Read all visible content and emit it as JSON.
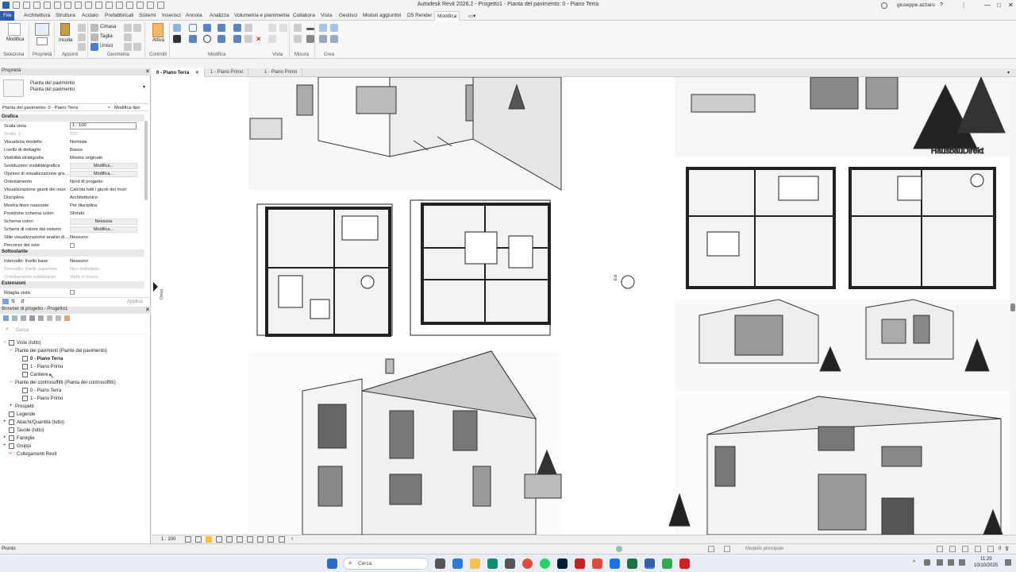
{
  "window": {
    "title": "Autodesk Revit 2026.2 - Progetto1 - Pianta del pavimento: 0 - Piano Terra",
    "user": "giuseppe.azzaro"
  },
  "menu": {
    "tabs": [
      "File",
      "Architettura",
      "Struttura",
      "Acciaio",
      "Prefabbricati",
      "Sistemi",
      "Inserisci",
      "Annota",
      "Analizza",
      "Volumetria e planimetria",
      "Collabora",
      "Vista",
      "Gestisci",
      "Moduli aggiuntivi",
      "D5 Render",
      "Modifica"
    ],
    "active": "Modifica"
  },
  "ribbon": {
    "modify_button": "Modifica",
    "paste_button": "Incolla",
    "cope": "Cimasa",
    "cut": "Taglia",
    "join": "Unisci",
    "activate_button": "Attiva",
    "groups": [
      "Seleziona",
      "Proprietà",
      "Appunti",
      "Geometria",
      "Controlli",
      "Modifica",
      "Vista",
      "Misura",
      "Crea"
    ]
  },
  "properties": {
    "header": "Proprietà",
    "type_line1": "Pianta del pavimento",
    "type_line2": "Pianta del pavimento",
    "instance_label": "Pianta del pavimento: 0 - Piano Terra",
    "edit_type": "Modifica tipo",
    "section_graphics": "Grafica",
    "rows": [
      {
        "k": "Scala vista",
        "v": "1 : 100"
      },
      {
        "k": "Scala: 1",
        "v": "100",
        "dim": true
      },
      {
        "k": "Visualizza modello",
        "v": "Normale"
      },
      {
        "k": "Livello di dettaglio",
        "v": "Basso"
      },
      {
        "k": "Visibilità stratigrafia",
        "v": "Mostra originale"
      },
      {
        "k": "Sostituzioni visibilità/grafica",
        "btn": "Modifica..."
      },
      {
        "k": "Opzioni di visualizzazione gra...",
        "btn": "Modifica..."
      },
      {
        "k": "Orientamento",
        "v": "Nord di progetto"
      },
      {
        "k": "Visualizzazione giunti dei muri",
        "v": "Calcola tutti i giunti dei muri"
      },
      {
        "k": "Disciplina",
        "v": "Architettonico"
      },
      {
        "k": "Mostra linee nascoste",
        "v": "Per disciplina"
      },
      {
        "k": "Posizione schema colori",
        "v": "Sfondo"
      },
      {
        "k": "Schema colori",
        "btn": "Nessuna"
      },
      {
        "k": "Schemi di colore dei sistemi",
        "btn": "Modifica..."
      },
      {
        "k": "Stile visualizzazione analisi di ...",
        "v": "Nessuno"
      },
      {
        "k": "Percorso del sole",
        "v": ""
      }
    ],
    "section_underlay": "Sottostante",
    "underlay_rows": [
      {
        "k": "Intervallo: livello base",
        "v": "Nessuno"
      },
      {
        "k": "Intervallo: livello superiore",
        "v": "Non delimitato",
        "dim": true
      },
      {
        "k": "Orientamento sottostante",
        "v": "Vista in basso",
        "dim": true
      }
    ],
    "section_extents": "Estensioni",
    "crop_view": "Ritaglia vista",
    "apply": "Applica"
  },
  "browser": {
    "header": "Browser di progetto - Progetto1",
    "search_placeholder": "Cerca",
    "tree": {
      "views": "Viste (tutto)",
      "floor_plans": "Piante dei pavimenti (Piante del pavimento)",
      "fp_items": [
        "0 - Piano Terra",
        "1 - Piano Primo",
        "Cantiere"
      ],
      "ceiling_plans": "Piante dei controsoffitti (Pianta dei controsoffitti)",
      "cp_items": [
        "0 - Piano Terra",
        "1 - Piano Primo"
      ],
      "elevations": "Prospetti",
      "legends": "Legende",
      "schedules": "Abachi/Quantità (tutto)",
      "sheets": "Tavole (tutto)",
      "families": "Famiglie",
      "groups": "Gruppi",
      "links": "Collegamenti Revit"
    }
  },
  "view_tabs": [
    "0 - Piano Terra",
    "1 - Piano Primo",
    "1 - Piano Primo"
  ],
  "canvas": {
    "watermark": "HausbauDirekt",
    "elev_west": "Ovest",
    "elev_east": "Est"
  },
  "viewbar": {
    "scale": "1 : 100"
  },
  "status": {
    "text": "Pronto",
    "model": "Modello principale",
    "zero": "0"
  },
  "taskbar": {
    "search": "Cerca",
    "time": "11:29",
    "date": "10/10/2025"
  }
}
